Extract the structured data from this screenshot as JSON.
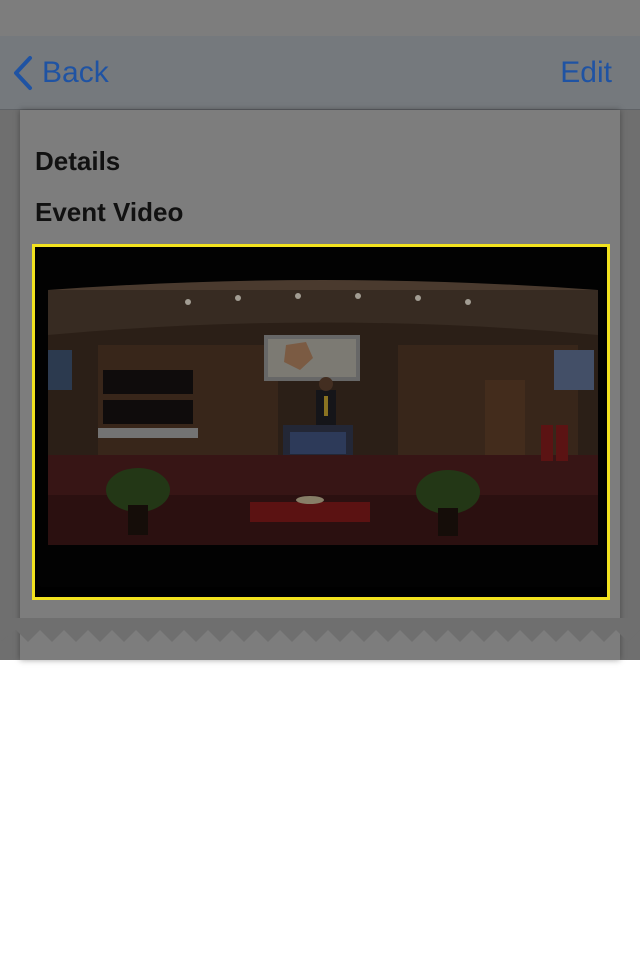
{
  "nav": {
    "back_label": "Back",
    "edit_label": "Edit"
  },
  "content": {
    "details_heading": "Details",
    "event_video_heading": "Event Video"
  },
  "colors": {
    "accent": "#1f53a3",
    "highlight_border": "#f2e21f"
  }
}
